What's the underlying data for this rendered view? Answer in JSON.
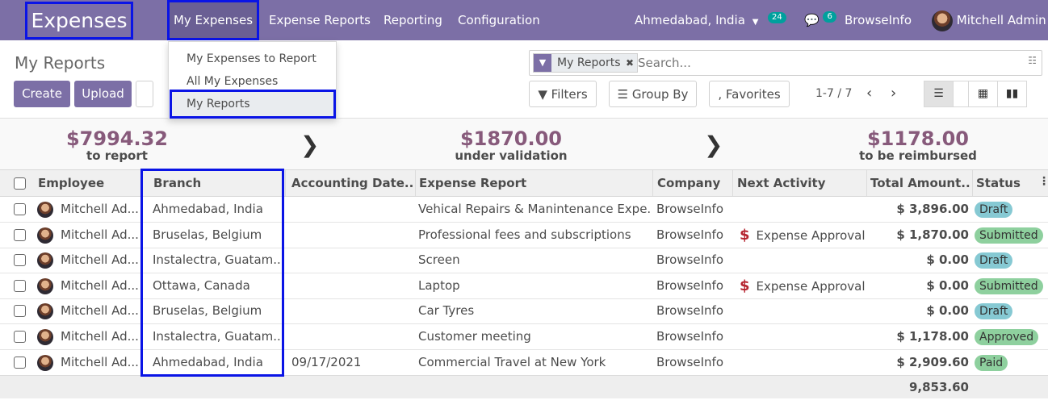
{
  "navbar": {
    "app_name": "Expenses",
    "menus": [
      "My Expenses",
      "Expense Reports",
      "Reporting",
      "Configuration"
    ],
    "branch": "Ahmedabad, India",
    "activity_count": "24",
    "message_count": "6",
    "company": "BrowseInfo",
    "user": "Mitchell Admin"
  },
  "dropdown": {
    "items": [
      "My Expenses to Report",
      "All My Expenses",
      "My Reports"
    ]
  },
  "control": {
    "title": "My Reports",
    "create_label": "Create",
    "upload_label": "Upload",
    "facet_label": "My Reports",
    "search_placeholder": "Search...",
    "filters_label": "Filters",
    "groupby_label": "Group By",
    "favorites_label": "Favorites",
    "pager": "1-7 / 7"
  },
  "stats": [
    {
      "amount": "$7994.32",
      "label": "to report"
    },
    {
      "amount": "$1870.00",
      "label": "under validation"
    },
    {
      "amount": "$1178.00",
      "label": "to be reimbursed"
    }
  ],
  "columns": [
    "Employee",
    "Branch",
    "Accounting Date...",
    "Expense Report",
    "Company",
    "Next Activity",
    "Total Amount...",
    "Status"
  ],
  "rows": [
    {
      "employee": "Mitchell Ad...",
      "branch": "Ahmedabad, India",
      "date": "",
      "report": "Vehical Repairs & Manintenance Expe...",
      "company": "BrowseInfo",
      "activity": "",
      "amount": "$ 3,896.00",
      "status": "Draft"
    },
    {
      "employee": "Mitchell Ad...",
      "branch": "Bruselas, Belgium",
      "date": "",
      "report": "Professional fees and subscriptions",
      "company": "BrowseInfo",
      "activity": "Expense Approval",
      "amount": "$ 1,870.00",
      "status": "Submitted"
    },
    {
      "employee": "Mitchell Ad...",
      "branch": "Instalectra, Guatam...",
      "date": "",
      "report": "Screen",
      "company": "BrowseInfo",
      "activity": "",
      "amount": "$ 0.00",
      "status": "Draft"
    },
    {
      "employee": "Mitchell Ad...",
      "branch": "Ottawa, Canada",
      "date": "",
      "report": "Laptop",
      "company": "BrowseInfo",
      "activity": "Expense Approval",
      "amount": "$ 0.00",
      "status": "Submitted"
    },
    {
      "employee": "Mitchell Ad...",
      "branch": "Bruselas, Belgium",
      "date": "",
      "report": "Car Tyres",
      "company": "BrowseInfo",
      "activity": "",
      "amount": "$ 0.00",
      "status": "Draft"
    },
    {
      "employee": "Mitchell Ad...",
      "branch": "Instalectra, Guatam...",
      "date": "",
      "report": "Customer meeting",
      "company": "BrowseInfo",
      "activity": "",
      "amount": "$ 1,178.00",
      "status": "Approved"
    },
    {
      "employee": "Mitchell Ad...",
      "branch": "Ahmedabad, India",
      "date": "09/17/2021",
      "report": "Commercial Travel at New York",
      "company": "BrowseInfo",
      "activity": "",
      "amount": "$ 2,909.60",
      "status": "Paid"
    }
  ],
  "footer_total": "9,853.60",
  "colors": {
    "brand": "#7c6fa6",
    "highlight": "#0a14e6",
    "stat": "#875a7b",
    "draft": "#86c9d3",
    "green": "#8ed09e"
  },
  "icons": [
    "caret-down-icon",
    "chat-icon",
    "filter-icon",
    "close-icon",
    "toggle-icon",
    "chevron-left-icon",
    "chevron-right-icon",
    "list-view-icon",
    "grid-view-icon",
    "graph-view-icon",
    "dollar-icon",
    "column-options-icon"
  ]
}
